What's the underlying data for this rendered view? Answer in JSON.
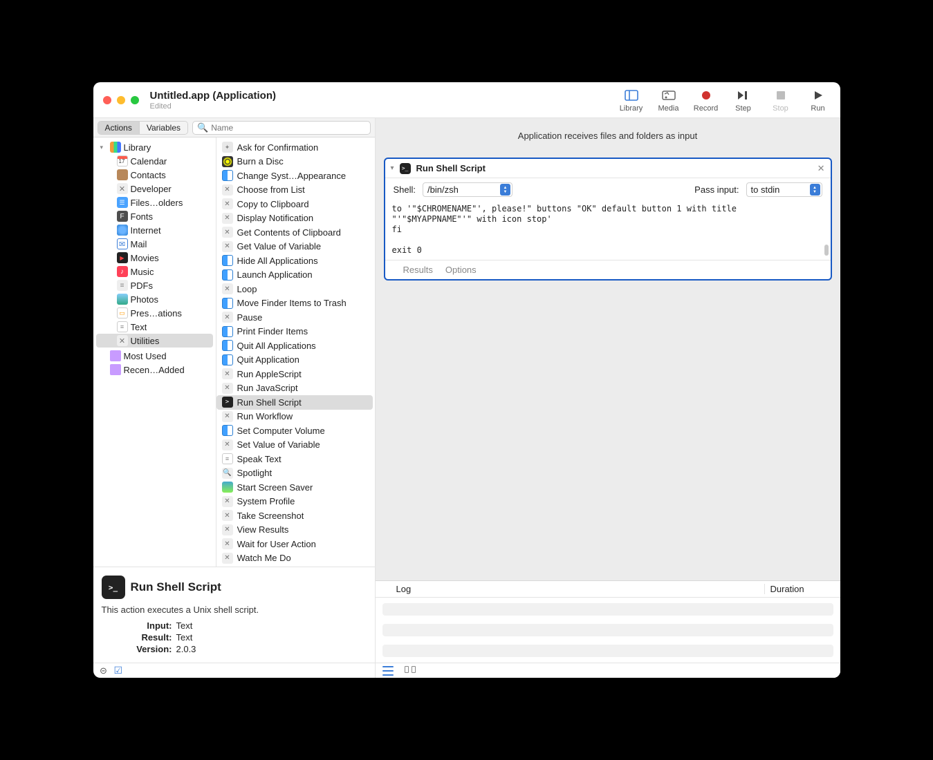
{
  "window": {
    "title": "Untitled.app (Application)",
    "subtitle": "Edited"
  },
  "toolbar": {
    "library": "Library",
    "media": "Media",
    "record": "Record",
    "step": "Step",
    "stop": "Stop",
    "run": "Run"
  },
  "tabs": {
    "actions": "Actions",
    "variables": "Variables"
  },
  "search": {
    "placeholder": "Name"
  },
  "library_tree": {
    "root": "Library",
    "items": [
      {
        "label": "Calendar",
        "icon": "ic-cal"
      },
      {
        "label": "Contacts",
        "icon": "ic-contacts"
      },
      {
        "label": "Developer",
        "icon": "ic-dev"
      },
      {
        "label": "Files…olders",
        "icon": "ic-files"
      },
      {
        "label": "Fonts",
        "icon": "ic-fonts"
      },
      {
        "label": "Internet",
        "icon": "ic-net"
      },
      {
        "label": "Mail",
        "icon": "ic-mail"
      },
      {
        "label": "Movies",
        "icon": "ic-movies"
      },
      {
        "label": "Music",
        "icon": "ic-music"
      },
      {
        "label": "PDFs",
        "icon": "ic-pdf"
      },
      {
        "label": "Photos",
        "icon": "ic-photos"
      },
      {
        "label": "Pres…ations",
        "icon": "ic-pres"
      },
      {
        "label": "Text",
        "icon": "ic-text"
      },
      {
        "label": "Utilities",
        "icon": "ic-util",
        "selected": true
      }
    ],
    "extras": [
      {
        "label": "Most Used",
        "icon": "ic-folder"
      },
      {
        "label": "Recen…Added",
        "icon": "ic-folder"
      }
    ]
  },
  "actions": [
    {
      "label": "Ask for Confirmation",
      "icon": "ic-auto"
    },
    {
      "label": "Burn a Disc",
      "icon": "ic-disc"
    },
    {
      "label": "Change Syst…Appearance",
      "icon": "ic-finder"
    },
    {
      "label": "Choose from List",
      "icon": "ic-wrench"
    },
    {
      "label": "Copy to Clipboard",
      "icon": "ic-wrench"
    },
    {
      "label": "Display Notification",
      "icon": "ic-wrench"
    },
    {
      "label": "Get Contents of Clipboard",
      "icon": "ic-wrench"
    },
    {
      "label": "Get Value of Variable",
      "icon": "ic-wrench"
    },
    {
      "label": "Hide All Applications",
      "icon": "ic-finder"
    },
    {
      "label": "Launch Application",
      "icon": "ic-finder"
    },
    {
      "label": "Loop",
      "icon": "ic-wrench"
    },
    {
      "label": "Move Finder Items to Trash",
      "icon": "ic-finder"
    },
    {
      "label": "Pause",
      "icon": "ic-wrench"
    },
    {
      "label": "Print Finder Items",
      "icon": "ic-finder"
    },
    {
      "label": "Quit All Applications",
      "icon": "ic-finder"
    },
    {
      "label": "Quit Application",
      "icon": "ic-finder"
    },
    {
      "label": "Run AppleScript",
      "icon": "ic-wrench"
    },
    {
      "label": "Run JavaScript",
      "icon": "ic-wrench"
    },
    {
      "label": "Run Shell Script",
      "icon": "ic-term",
      "selected": true
    },
    {
      "label": "Run Workflow",
      "icon": "ic-wrench"
    },
    {
      "label": "Set Computer Volume",
      "icon": "ic-finder"
    },
    {
      "label": "Set Value of Variable",
      "icon": "ic-wrench"
    },
    {
      "label": "Speak Text",
      "icon": "ic-text"
    },
    {
      "label": "Spotlight",
      "icon": "ic-loupe"
    },
    {
      "label": "Start Screen Saver",
      "icon": "ic-saver"
    },
    {
      "label": "System Profile",
      "icon": "ic-wrench"
    },
    {
      "label": "Take Screenshot",
      "icon": "ic-wrench"
    },
    {
      "label": "View Results",
      "icon": "ic-wrench"
    },
    {
      "label": "Wait for User Action",
      "icon": "ic-wrench"
    },
    {
      "label": "Watch Me Do",
      "icon": "ic-wrench"
    }
  ],
  "info": {
    "title": "Run Shell Script",
    "desc": "This action executes a Unix shell script.",
    "input_k": "Input:",
    "input_v": "Text",
    "result_k": "Result:",
    "result_v": "Text",
    "version_k": "Version:",
    "version_v": "2.0.3"
  },
  "workflow": {
    "hint": "Application receives files and folders as input",
    "card": {
      "title": "Run Shell Script",
      "shell_label": "Shell:",
      "shell_value": "/bin/zsh",
      "pass_label": "Pass input:",
      "pass_value": "to stdin",
      "code": "to '\"$CHROMENAME\"', please!\" buttons \"OK\" default button 1 with title\n\"'\"$MYAPPNAME\"'\" with icon stop'\nfi\n\nexit 0",
      "results": "Results",
      "options": "Options"
    },
    "log": {
      "col1": "Log",
      "col2": "Duration"
    }
  }
}
